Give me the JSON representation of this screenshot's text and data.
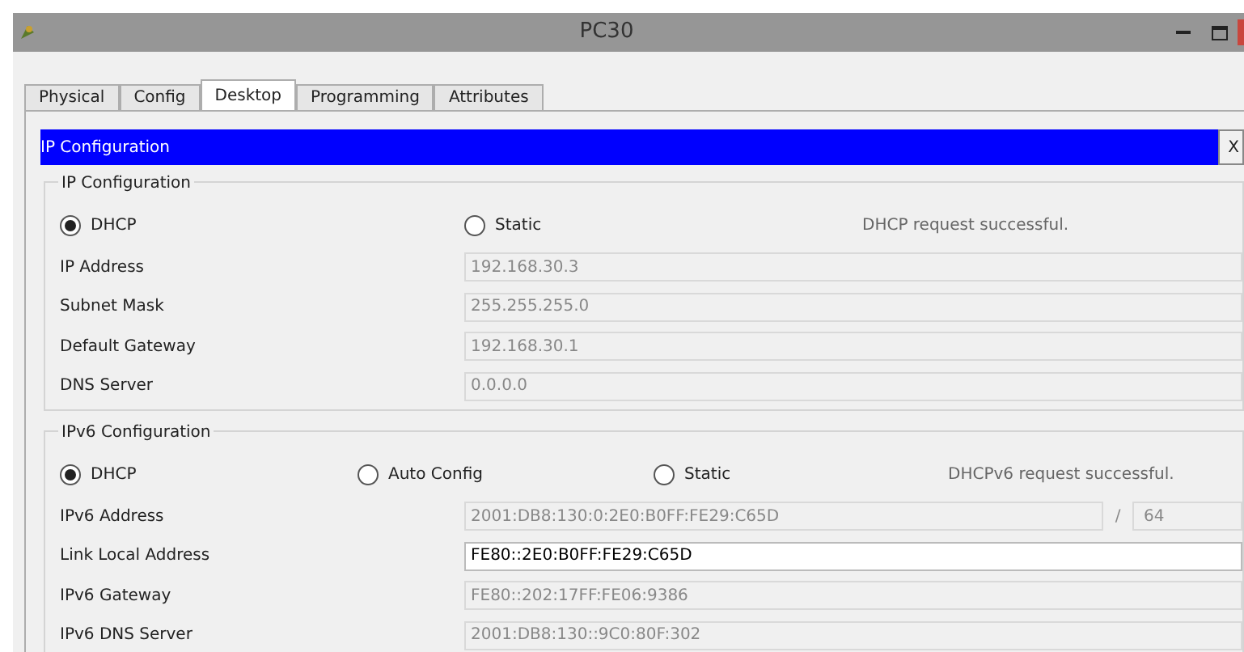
{
  "window": {
    "title": "PC30"
  },
  "tabs": [
    {
      "label": "Physical",
      "selected": false
    },
    {
      "label": "Config",
      "selected": false
    },
    {
      "label": "Desktop",
      "selected": true
    },
    {
      "label": "Programming",
      "selected": false
    },
    {
      "label": "Attributes",
      "selected": false
    }
  ],
  "panel": {
    "title": "IP Configuration",
    "close": "X"
  },
  "ipv4": {
    "legend": "IP Configuration",
    "modes": [
      {
        "label": "DHCP",
        "selected": true
      },
      {
        "label": "Static",
        "selected": false
      }
    ],
    "status": "DHCP request successful.",
    "fields": [
      {
        "label": "IP Address",
        "value": "192.168.30.3",
        "disabled": true
      },
      {
        "label": "Subnet Mask",
        "value": "255.255.255.0",
        "disabled": true
      },
      {
        "label": "Default Gateway",
        "value": "192.168.30.1",
        "disabled": true
      },
      {
        "label": "DNS Server",
        "value": "0.0.0.0",
        "disabled": true
      }
    ]
  },
  "ipv6": {
    "legend": "IPv6 Configuration",
    "modes": [
      {
        "label": "DHCP",
        "selected": true
      },
      {
        "label": "Auto Config",
        "selected": false
      },
      {
        "label": "Static",
        "selected": false
      }
    ],
    "status": "DHCPv6 request successful.",
    "fields": [
      {
        "label": "IPv6 Address",
        "value": "2001:DB8:130:0:2E0:B0FF:FE29:C65D",
        "disabled": true,
        "separator": "/",
        "prefix": "64"
      },
      {
        "label": "Link Local Address",
        "value": "FE80::2E0:B0FF:FE29:C65D",
        "disabled": false
      },
      {
        "label": "IPv6 Gateway",
        "value": "FE80::202:17FF:FE06:9386",
        "disabled": true
      },
      {
        "label": "IPv6 DNS Server",
        "value": "2001:DB8:130::9C0:80F:302",
        "disabled": true
      }
    ]
  }
}
